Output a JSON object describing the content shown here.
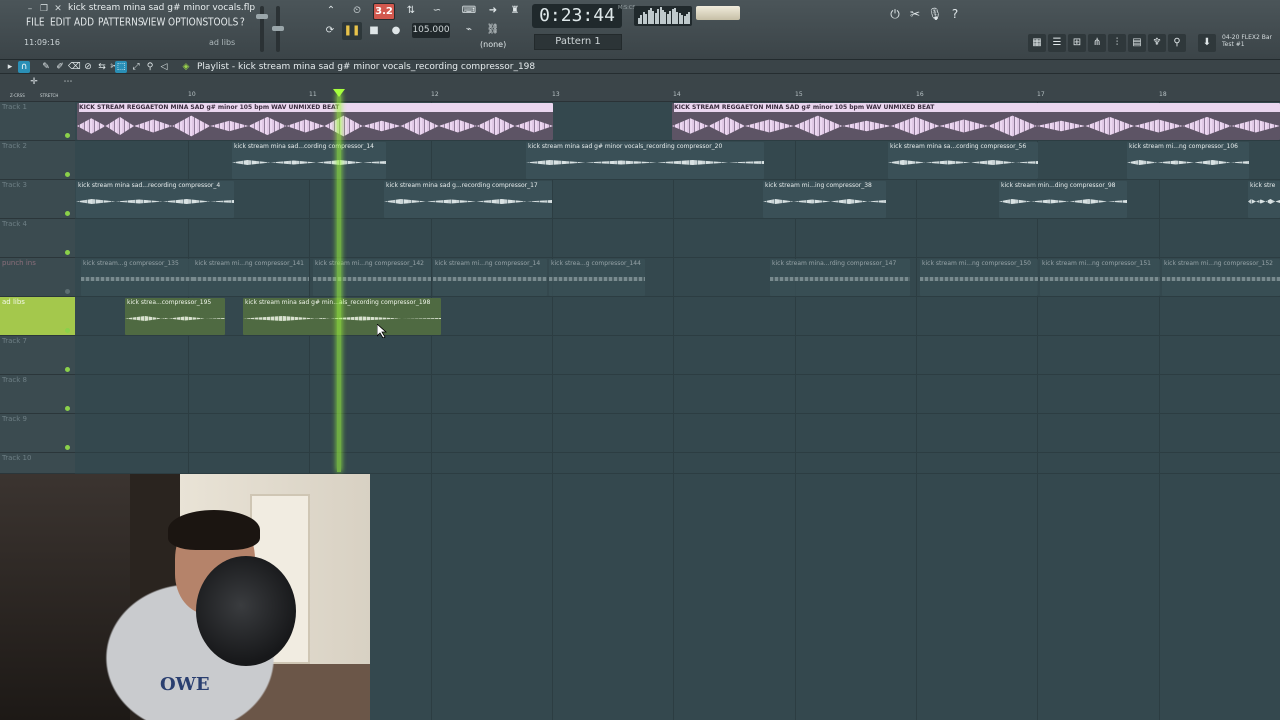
{
  "window": {
    "file_title": "kick stream mina sad g# minor vocals.flp",
    "menus": [
      "FILE",
      "EDIT",
      "ADD",
      "PATTERNS",
      "VIEW",
      "OPTIONS",
      "TOOLS",
      "?"
    ],
    "hint_left": "11:09:16",
    "hint_right": "ad libs"
  },
  "transport": {
    "song_pos_label": "3.2",
    "tempo": "105.000",
    "snap": "(none)",
    "pattern": "Pattern 1",
    "time": "0:23:44",
    "time_unit": "M:S:CS"
  },
  "news": {
    "line1": "04-20  FLEX2 Bar",
    "line2": "Test #1"
  },
  "playlist": {
    "title": "Playlist - kick stream mina sad g# minor vocals_recording compressor_198",
    "ruler_ticks": [
      "10",
      "11",
      "12",
      "13",
      "14",
      "15",
      "16",
      "17",
      "18"
    ],
    "small_tags": [
      "Z-CRSS",
      "STRETCH"
    ]
  },
  "tracks": [
    {
      "name": "Track 1",
      "clips": [
        {
          "label": "KICK STREAM REGGAETON MINA SAD g# minor 105 bpm WAV UNMIXED BEAT",
          "kind": "beat"
        },
        {
          "label": "KICK STREAM REGGAETON MINA SAD g# minor 105 bpm WAV UNMIXED BEAT",
          "kind": "beat"
        }
      ]
    },
    {
      "name": "Track 2",
      "clips": [
        {
          "label": "kick stream mina sad...cording compressor_14",
          "kind": "vocal"
        },
        {
          "label": "kick stream mina sad g# minor vocals_recording compressor_20",
          "kind": "vocal"
        },
        {
          "label": "kick stream mina sa...cording compressor_56",
          "kind": "vocal"
        },
        {
          "label": "kick stream mi...ng compressor_106",
          "kind": "vocal"
        }
      ]
    },
    {
      "name": "Track 3",
      "clips": [
        {
          "label": "kick stream mina sad...recording compressor_4",
          "kind": "vocal"
        },
        {
          "label": "kick stream mina sad g...recording compressor_17",
          "kind": "vocal"
        },
        {
          "label": "kick stream mi...ing compressor_38",
          "kind": "vocal"
        },
        {
          "label": "kick stream min...ding compressor_98",
          "kind": "vocal"
        },
        {
          "label": "kick stre",
          "kind": "vocal"
        }
      ]
    },
    {
      "name": "Track 4",
      "clips": []
    },
    {
      "name": "punch ins",
      "clips": [
        {
          "label": "kick stream...g compressor_135",
          "kind": "punch"
        },
        {
          "label": "kick stream mi...ng compressor_141",
          "kind": "punch"
        },
        {
          "label": "kick stream mi...ng compressor_142",
          "kind": "punch"
        },
        {
          "label": "kick stream mi...ng compressor_14",
          "kind": "punch"
        },
        {
          "label": "kick strea...g compressor_144",
          "kind": "punch"
        },
        {
          "label": "kick stream mina...rding compressor_147",
          "kind": "punch"
        },
        {
          "label": "kick stream mi...ng compressor_150",
          "kind": "punch"
        },
        {
          "label": "kick stream mi...ng compressor_151",
          "kind": "punch"
        },
        {
          "label": "kick stream mi...ng compressor_152",
          "kind": "punch"
        }
      ]
    },
    {
      "name": "ad libs",
      "clips": [
        {
          "label": "kick strea...compressor_195",
          "kind": "adlib"
        },
        {
          "label": "kick stream mina sad g# min...als_recording compressor_198",
          "kind": "adlib"
        }
      ]
    },
    {
      "name": "Track 7",
      "clips": []
    },
    {
      "name": "Track 8",
      "clips": []
    },
    {
      "name": "Track 9",
      "clips": []
    },
    {
      "name": "Track 10",
      "clips": []
    }
  ],
  "webcam": {
    "shirt_text": "OWE"
  }
}
